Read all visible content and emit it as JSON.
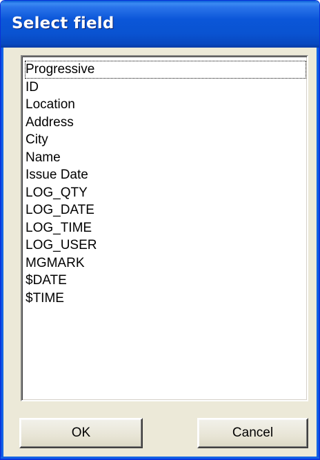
{
  "window": {
    "title": "Select field"
  },
  "field_list": {
    "items": [
      "Progressive",
      "ID",
      "Location",
      "Address",
      "City",
      "Name",
      "Issue Date",
      "LOG_QTY",
      "LOG_DATE",
      "LOG_TIME",
      "LOG_USER",
      "MGMARK",
      "$DATE",
      "$TIME"
    ],
    "focused_item": "Progressive"
  },
  "buttons": {
    "ok_label": "OK",
    "cancel_label": "Cancel"
  },
  "colors": {
    "titlebar_blue": "#0a53d1",
    "dialog_face": "#ece9d8",
    "list_background": "#ffffff"
  }
}
